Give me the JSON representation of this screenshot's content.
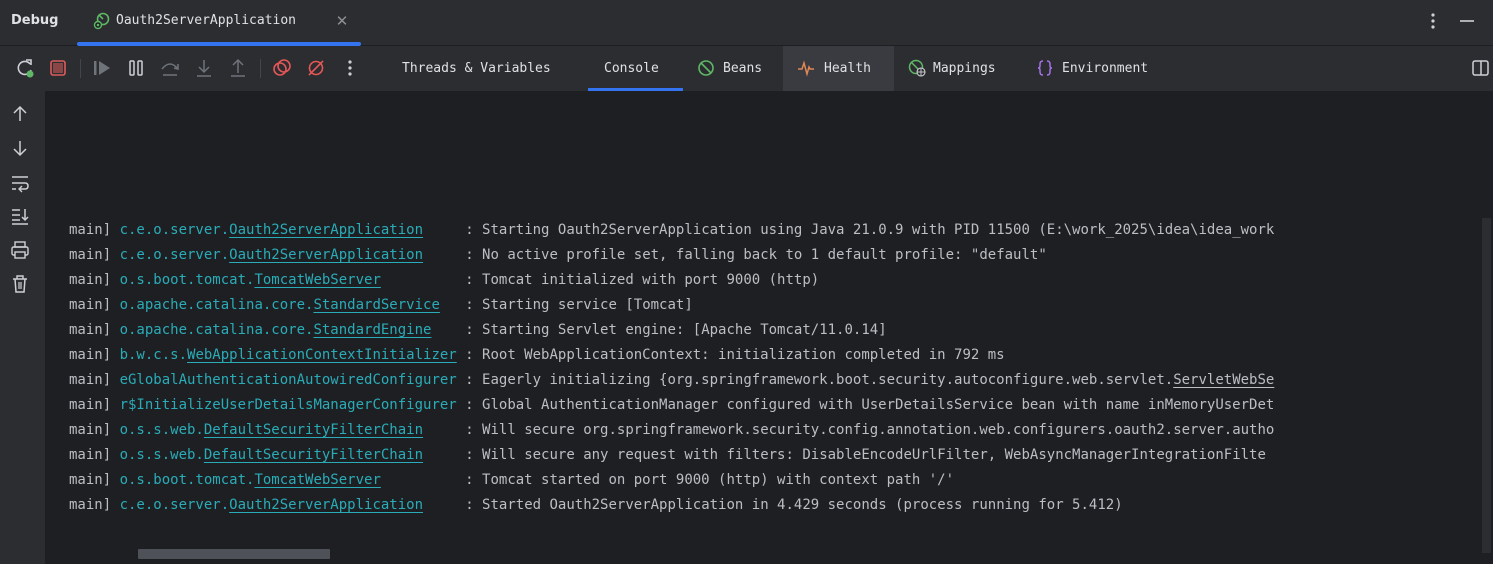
{
  "topbar": {
    "debug_label": "Debug",
    "run_tab_title": "Oauth2ServerApplication",
    "close_glyph": "✕",
    "icons": [
      "run-config-icon",
      "close-icon",
      "more-vertical-icon",
      "minimize-icon"
    ]
  },
  "toolbar": {
    "buttons": [
      "rerun-icon",
      "stop-icon",
      "resume-icon",
      "pause-icon",
      "step-over-icon",
      "step-into-icon",
      "step-out-icon",
      "view-breakpoints-icon",
      "mute-breakpoints-icon",
      "more-options-icon"
    ],
    "tabs": [
      {
        "label": "Threads & Variables",
        "icon": ""
      },
      {
        "label": "Console",
        "icon": ""
      },
      {
        "label": "Beans",
        "icon": "beans-icon"
      },
      {
        "label": "Health",
        "icon": "health-icon"
      },
      {
        "label": "Mappings",
        "icon": "mappings-icon"
      },
      {
        "label": "Environment",
        "icon": "environment-icon"
      }
    ],
    "active_tab": "Console",
    "hover_tab": "Health"
  },
  "gutter": {
    "buttons": [
      "up-arrow-icon",
      "down-arrow-icon",
      "soft-wrap-icon",
      "scroll-to-end-icon",
      "print-icon",
      "clear-all-icon"
    ]
  },
  "console": {
    "lines": [
      {
        "thread": "main] ",
        "pkg": "c.e.o.server.",
        "cls": "Oauth2ServerApplication",
        "pad": "     ",
        "msg": ": Starting Oauth2ServerApplication using Java 21.0.9 with PID 11500 (E:\\work_2025\\idea\\idea_work",
        "link": "",
        "tail": ""
      },
      {
        "thread": "main] ",
        "pkg": "c.e.o.server.",
        "cls": "Oauth2ServerApplication",
        "pad": "     ",
        "msg": ": No active profile set, falling back to 1 default profile: \"default\"",
        "link": "",
        "tail": ""
      },
      {
        "thread": "main] ",
        "pkg": "o.s.boot.tomcat.",
        "cls": "TomcatWebServer",
        "pad": "          ",
        "msg": ": Tomcat initialized with port 9000 (http)",
        "link": "",
        "tail": ""
      },
      {
        "thread": "main] ",
        "pkg": "o.apache.catalina.core.",
        "cls": "StandardService",
        "pad": "   ",
        "msg": ": Starting service [Tomcat]",
        "link": "",
        "tail": ""
      },
      {
        "thread": "main] ",
        "pkg": "o.apache.catalina.core.",
        "cls": "StandardEngine",
        "pad": "    ",
        "msg": ": Starting Servlet engine: [Apache Tomcat/11.0.14]",
        "link": "",
        "tail": ""
      },
      {
        "thread": "main] ",
        "pkg": "b.w.c.s.",
        "cls": "WebApplicationContextInitializer",
        "pad": " ",
        "msg": ": Root WebApplicationContext: initialization completed in 792 ms",
        "link": "",
        "tail": ""
      },
      {
        "thread": "main] ",
        "pkg": "",
        "cls": "",
        "pkgplain": "eGlobalAuthenticationAutowiredConfigurer",
        "pad": " ",
        "msg": ": Eagerly initializing {org.springframework.boot.security.autoconfigure.web.servlet.",
        "link": "ServletWebSe",
        "tail": ""
      },
      {
        "thread": "main] ",
        "pkg": "",
        "cls": "",
        "pkgplain": "r$InitializeUserDetailsManagerConfigurer",
        "pad": " ",
        "msg": ": Global AuthenticationManager configured with UserDetailsService bean with name inMemoryUserDet",
        "link": "",
        "tail": ""
      },
      {
        "thread": "main] ",
        "pkg": "o.s.s.web.",
        "cls": "DefaultSecurityFilterChain",
        "pad": "     ",
        "msg": ": Will secure org.springframework.security.config.annotation.web.configurers.oauth2.server.autho",
        "link": "",
        "tail": ""
      },
      {
        "thread": "main] ",
        "pkg": "o.s.s.web.",
        "cls": "DefaultSecurityFilterChain",
        "pad": "     ",
        "msg": ": Will secure any request with filters: DisableEncodeUrlFilter, WebAsyncManagerIntegrationFilte",
        "link": "",
        "tail": ""
      },
      {
        "thread": "main] ",
        "pkg": "o.s.boot.tomcat.",
        "cls": "TomcatWebServer",
        "pad": "          ",
        "msg": ": Tomcat started on port 9000 (http) with context path '/'",
        "link": "",
        "tail": ""
      },
      {
        "thread": "main] ",
        "pkg": "c.e.o.server.",
        "cls": "Oauth2ServerApplication",
        "pad": "     ",
        "msg": ": Started Oauth2ServerApplication in 4.429 seconds (process running for 5.412)",
        "link": "",
        "tail": ""
      }
    ]
  },
  "colors": {
    "accent": "#3574f0",
    "logger": "#2aacb8",
    "text": "#bcbec4",
    "stop": "#db5c5c",
    "breakpoint": "#e55757",
    "beans": "#5fb865",
    "health": "#e08855",
    "environment": "#a571e6"
  }
}
